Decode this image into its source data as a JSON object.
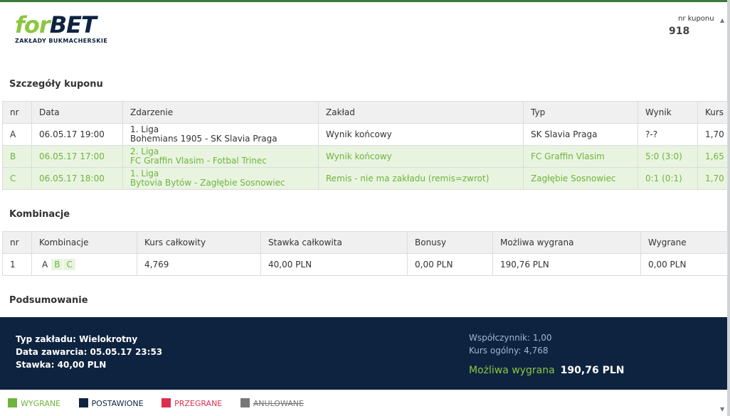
{
  "brand": {
    "logo_for": "for",
    "logo_bet": "BET",
    "logo_sub": "ZAKŁADY BUKMACHERSKIE"
  },
  "coupon": {
    "label": "nr kuponu",
    "number": "918"
  },
  "details": {
    "title": "Szczegóły kuponu",
    "headers": [
      "nr",
      "Data",
      "Zdarzenie",
      "Zakład",
      "Typ",
      "Wynik",
      "Kurs"
    ],
    "rows": [
      {
        "nr": "A",
        "date": "06.05.17 19:00",
        "league": "1. Liga",
        "event": "Bohemians 1905 - SK Slavia Praga",
        "bet": "Wynik końcowy",
        "type": "SK Slavia Praga",
        "result": "?-?",
        "odds": "1,70",
        "status": "neutral"
      },
      {
        "nr": "B",
        "date": "06.05.17 17:00",
        "league": "2. Liga",
        "event": "FC Graffin Vlasim - Fotbal Trinec",
        "bet": "Wynik końcowy",
        "type": "FC Graffin Vlasim",
        "result": "5:0 (3:0)",
        "odds": "1,65",
        "status": "won"
      },
      {
        "nr": "C",
        "date": "06.05.17 18:00",
        "league": "1. Liga",
        "event": "Bytovia Bytów - Zagłębie Sosnowiec",
        "bet": "Remis - nie ma zakładu (remis=zwrot)",
        "type": "Zagłębie Sosnowiec",
        "result": "0:1 (0:1)",
        "odds": "1,70",
        "status": "won"
      }
    ]
  },
  "combinations": {
    "title": "Kombinacje",
    "headers": [
      "nr",
      "Kombinacje",
      "Kurs całkowity",
      "Stawka całkowita",
      "Bonusy",
      "Możliwa wygrana",
      "Wygrane"
    ],
    "rows": [
      {
        "nr": "1",
        "tags": [
          "A",
          "B",
          "C"
        ],
        "total_odds": "4,769",
        "total_stake": "40,00 PLN",
        "bonus": "0,00 PLN",
        "possible_win": "190,76 PLN",
        "won": "0,00 PLN"
      }
    ]
  },
  "summary": {
    "title": "Podsumowanie",
    "bet_type": "Typ zakładu: Wielokrotny",
    "date": "Data zawarcia: 05.05.17 23:53",
    "stake": "Stawka: 40,00 PLN",
    "coefficient": "Współczynnik: 1,00",
    "total_odds": "Kurs ogólny: 4,768",
    "possible_win_label": "Możliwa wygrana",
    "possible_win_value": "190,76 PLN"
  },
  "legend": {
    "won": "WYGRANE",
    "placed": "POSTAWIONE",
    "lost": "PRZEGRANE",
    "cancelled": "ANULOWANE"
  },
  "colors": {
    "won": "#6fb33e",
    "placed": "#0e2340",
    "lost": "#d9314e",
    "cancelled": "#777777",
    "won_row_bg": "#e9f4e0"
  },
  "icons": {
    "scroll_up": "scroll-up-icon",
    "scroll_down": "scroll-down-icon"
  }
}
